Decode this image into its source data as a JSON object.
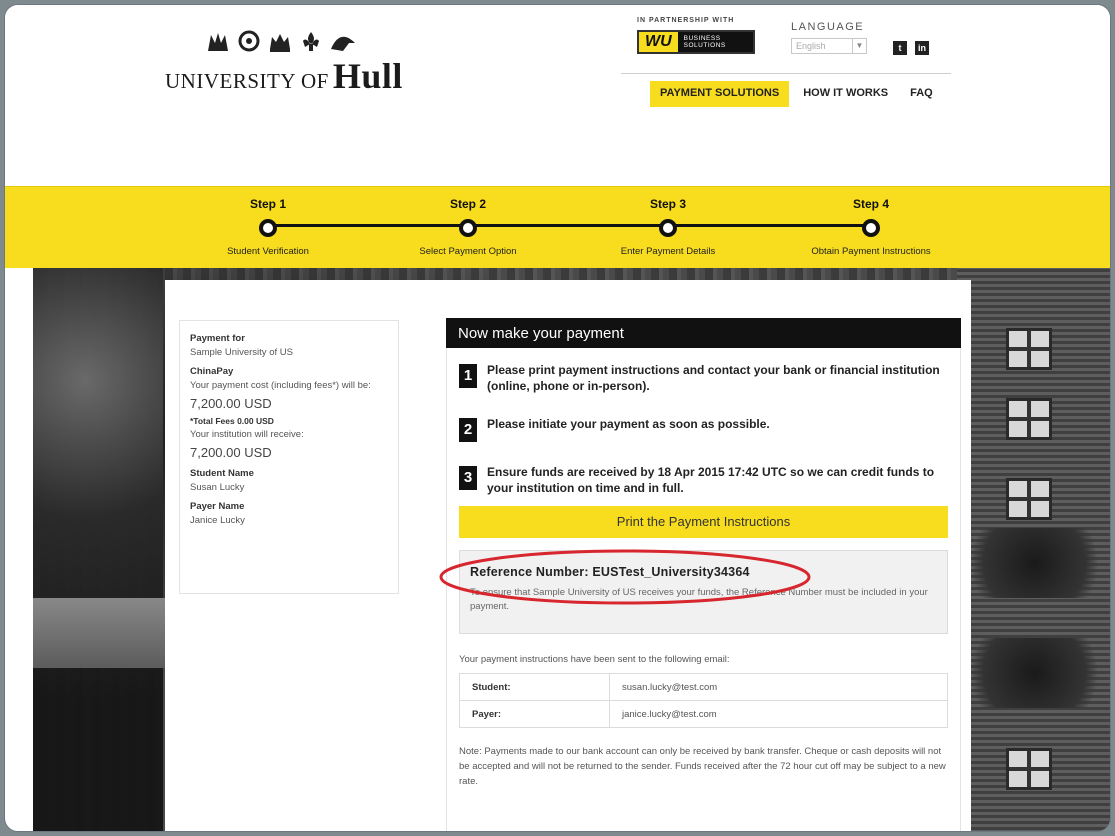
{
  "header": {
    "logo_small": "UNIVERSITY OF",
    "logo_big": "Hull",
    "partner_label": "IN PARTNERSHIP WITH",
    "wu_mark": "WU",
    "wu_text_1": "BUSINESS",
    "wu_text_2": "SOLUTIONS",
    "language_label": "LANGUAGE",
    "language_value": "English",
    "social_twitter": "t",
    "social_linkedin": "in",
    "nav": {
      "payment_solutions": "PAYMENT SOLUTIONS",
      "how_it_works": "HOW IT WORKS",
      "faq": "FAQ"
    }
  },
  "steps": [
    {
      "title": "Step 1",
      "label": "Student Verification"
    },
    {
      "title": "Step 2",
      "label": "Select Payment Option"
    },
    {
      "title": "Step 3",
      "label": "Enter Payment Details"
    },
    {
      "title": "Step 4",
      "label": "Obtain Payment Instructions"
    }
  ],
  "summary": {
    "payment_for_label": "Payment for",
    "payment_for_value": "Sample University of US",
    "method": "ChinaPay",
    "cost_label": "Your payment cost (including fees*) will be:",
    "cost_value": "7,200.00 USD",
    "fees": "*Total Fees 0.00 USD",
    "receive_label": "Your institution will receive:",
    "receive_value": "7,200.00 USD",
    "student_label": "Student Name",
    "student_value": "Susan Lucky",
    "payer_label": "Payer Name",
    "payer_value": "Janice Lucky"
  },
  "instructions": {
    "title": "Now make your payment",
    "steps": [
      {
        "num": "1",
        "text": "Please print payment instructions and contact your bank or financial institution (online, phone or in-person)."
      },
      {
        "num": "2",
        "text": "Please initiate your payment as soon as possible."
      },
      {
        "num": "3",
        "text": "Ensure funds are received by 18 Apr 2015 17:42 UTC so we can credit funds to your institution on time and in full."
      }
    ],
    "print_button": "Print the Payment Instructions",
    "reference": "Reference Number: EUSTest_University34364",
    "reference_note": "To ensure that Sample University of US receives your funds, the Reference Number must be included in your payment.",
    "sent_label": "Your payment instructions have been sent to the following email:",
    "emails": [
      {
        "role": "Student:",
        "email": "susan.lucky@test.com"
      },
      {
        "role": "Payer:",
        "email": "janice.lucky@test.com"
      }
    ],
    "note": "Note: Payments made to our bank account can only be received by bank transfer. Cheque or cash deposits will not be accepted and will not be returned to the sender. Funds received after the 72 hour cut off may be subject to a new rate."
  },
  "colors": {
    "accent_yellow": "#f7dd1e",
    "dark": "#111111",
    "highlight_oval": "#d7262e"
  }
}
